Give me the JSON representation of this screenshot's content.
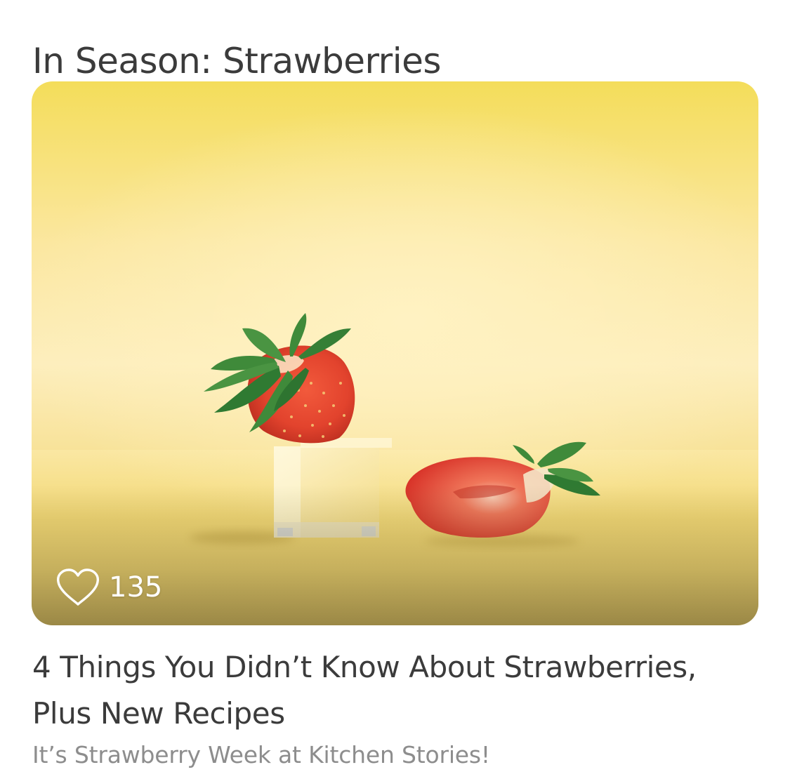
{
  "section": {
    "title": "In Season: Strawberries"
  },
  "card": {
    "likes": "135",
    "title": "4 Things You Didn’t Know About Strawberries, Plus New Recipes",
    "subtitle": "It’s Strawberry Week at Kitchen Stories!"
  },
  "icons": {
    "like": "heart-outline-icon"
  },
  "colors": {
    "title_text": "#3b3b3b",
    "subtitle_text": "#8d8d8d",
    "image_background": "#fbe7a0",
    "strawberry": "#e0442e",
    "leaves": "#3f8a3a"
  }
}
